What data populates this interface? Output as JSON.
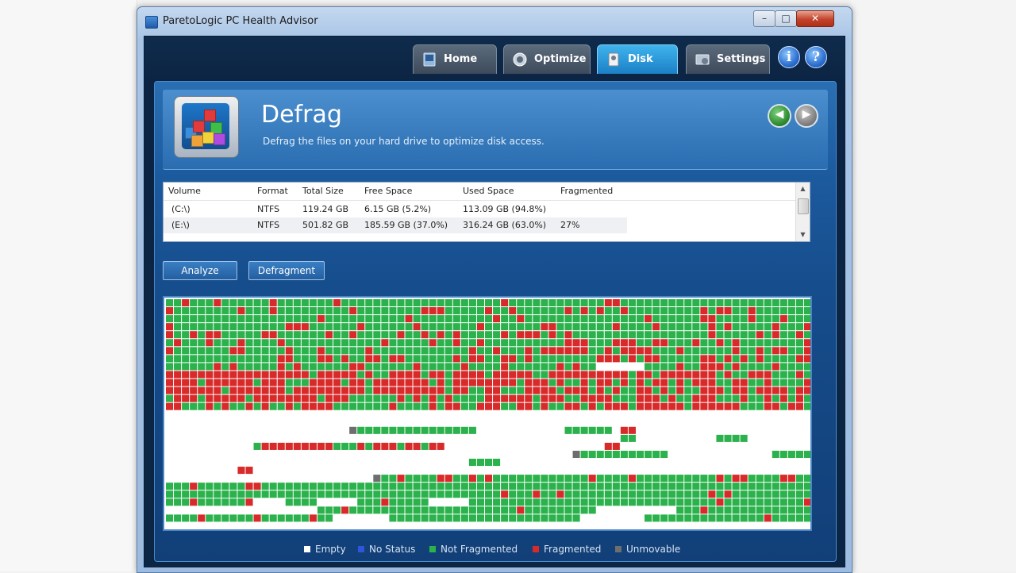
{
  "window": {
    "title": "ParetoLogic PC Health Advisor"
  },
  "titlebar_buttons": {
    "minimize": "–",
    "maximize": "□",
    "close": "✕"
  },
  "tabs": [
    {
      "label": "Home",
      "icon": "home-icon",
      "active": false
    },
    {
      "label": "Optimize",
      "icon": "optimize-icon",
      "active": false
    },
    {
      "label": "Disk",
      "icon": "disk-icon",
      "active": true
    },
    {
      "label": "Settings",
      "icon": "settings-icon",
      "active": false
    }
  ],
  "help_buttons": {
    "info": "i",
    "question": "?"
  },
  "header": {
    "title": "Defrag",
    "description": "Defrag the files on your hard drive to optimize disk access.",
    "icon": "defrag-cubes-icon"
  },
  "nav": {
    "back": "◀",
    "forward": "▶"
  },
  "volumes": {
    "columns": [
      "Volume",
      "Format",
      "Total Size",
      "Free Space",
      "Used Space",
      "Fragmented"
    ],
    "rows": [
      {
        "volume": "(C:\\)",
        "format": "NTFS",
        "total": "119.24 GB",
        "free": "6.15 GB (5.2%)",
        "used": "113.09 GB (94.8%)",
        "fragmented": ""
      },
      {
        "volume": "(E:\\)",
        "format": "NTFS",
        "total": "501.82 GB",
        "free": "185.59 GB (37.0%)",
        "used": "316.24 GB (63.0%)",
        "fragmented": "27%"
      }
    ]
  },
  "scrollbar": {
    "up": "▲",
    "down": "▼"
  },
  "actions": {
    "analyze": "Analyze",
    "defragment": "Defragment"
  },
  "legend": [
    {
      "label": "Empty",
      "color": "#ffffff"
    },
    {
      "label": "No Status",
      "color": "#2f56d6"
    },
    {
      "label": "Not Fragmented",
      "color": "#2bb24c"
    },
    {
      "label": "Fragmented",
      "color": "#d92a2a"
    },
    {
      "label": "Unmovable",
      "color": "#6e6e6e"
    }
  ],
  "map_colors": {
    "empty": "#ffffff",
    "not_fragmented": "#2bb24c",
    "fragmented": "#d92a2a",
    "unmovable": "#6e6e6e"
  }
}
